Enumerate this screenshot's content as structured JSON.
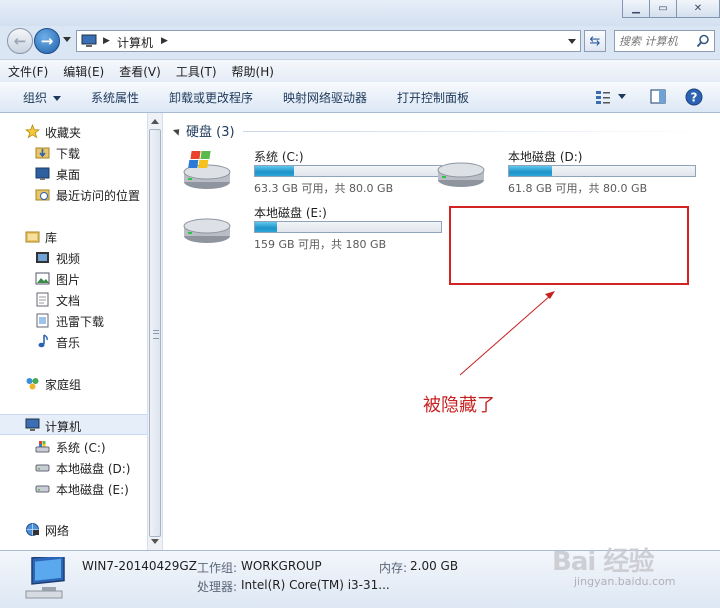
{
  "window": {
    "caption_buttons": [
      "minimize",
      "maximize",
      "close"
    ]
  },
  "address": {
    "crumbs": [
      "计算机"
    ]
  },
  "search": {
    "placeholder": "搜索 计算机"
  },
  "menu": [
    "文件(F)",
    "编辑(E)",
    "查看(V)",
    "工具(T)",
    "帮助(H)"
  ],
  "toolbar": {
    "organize": "组织",
    "items": [
      "系统属性",
      "卸载或更改程序",
      "映射网络驱动器",
      "打开控制面板"
    ]
  },
  "nav": {
    "favorites": "收藏夹",
    "favorite_items": [
      "下载",
      "桌面",
      "最近访问的位置"
    ],
    "libraries": "库",
    "library_items": [
      "视频",
      "图片",
      "文档",
      "迅雷下载",
      "音乐"
    ],
    "homegroup": "家庭组",
    "computer": "计算机",
    "computer_items": [
      "系统 (C:)",
      "本地磁盘 (D:)",
      "本地磁盘 (E:)"
    ],
    "network": "网络"
  },
  "group": {
    "title": "硬盘 (3)"
  },
  "drives": [
    {
      "name": "系统 (C:)",
      "info": "63.3 GB 可用，共 80.0 GB",
      "used_fraction": 0.21
    },
    {
      "name": "本地磁盘 (D:)",
      "info": "61.8 GB 可用，共 80.0 GB",
      "used_fraction": 0.23
    },
    {
      "name": "本地磁盘 (E:)",
      "info": "159 GB 可用，共 180 GB",
      "used_fraction": 0.12
    }
  ],
  "annotation": {
    "text": "被隐藏了",
    "color": "#c62222"
  },
  "details": {
    "computer_name": "WIN7-20140429GZ",
    "workgroup_label": "工作组:",
    "workgroup": "WORKGROUP",
    "memory_label": "内存:",
    "memory": "2.00 GB",
    "cpu_label": "处理器:",
    "cpu": "Intel(R) Core(TM) i3-31..."
  },
  "watermark": {
    "text": "Bai 经验",
    "sub": "jingyan.baidu.com"
  }
}
